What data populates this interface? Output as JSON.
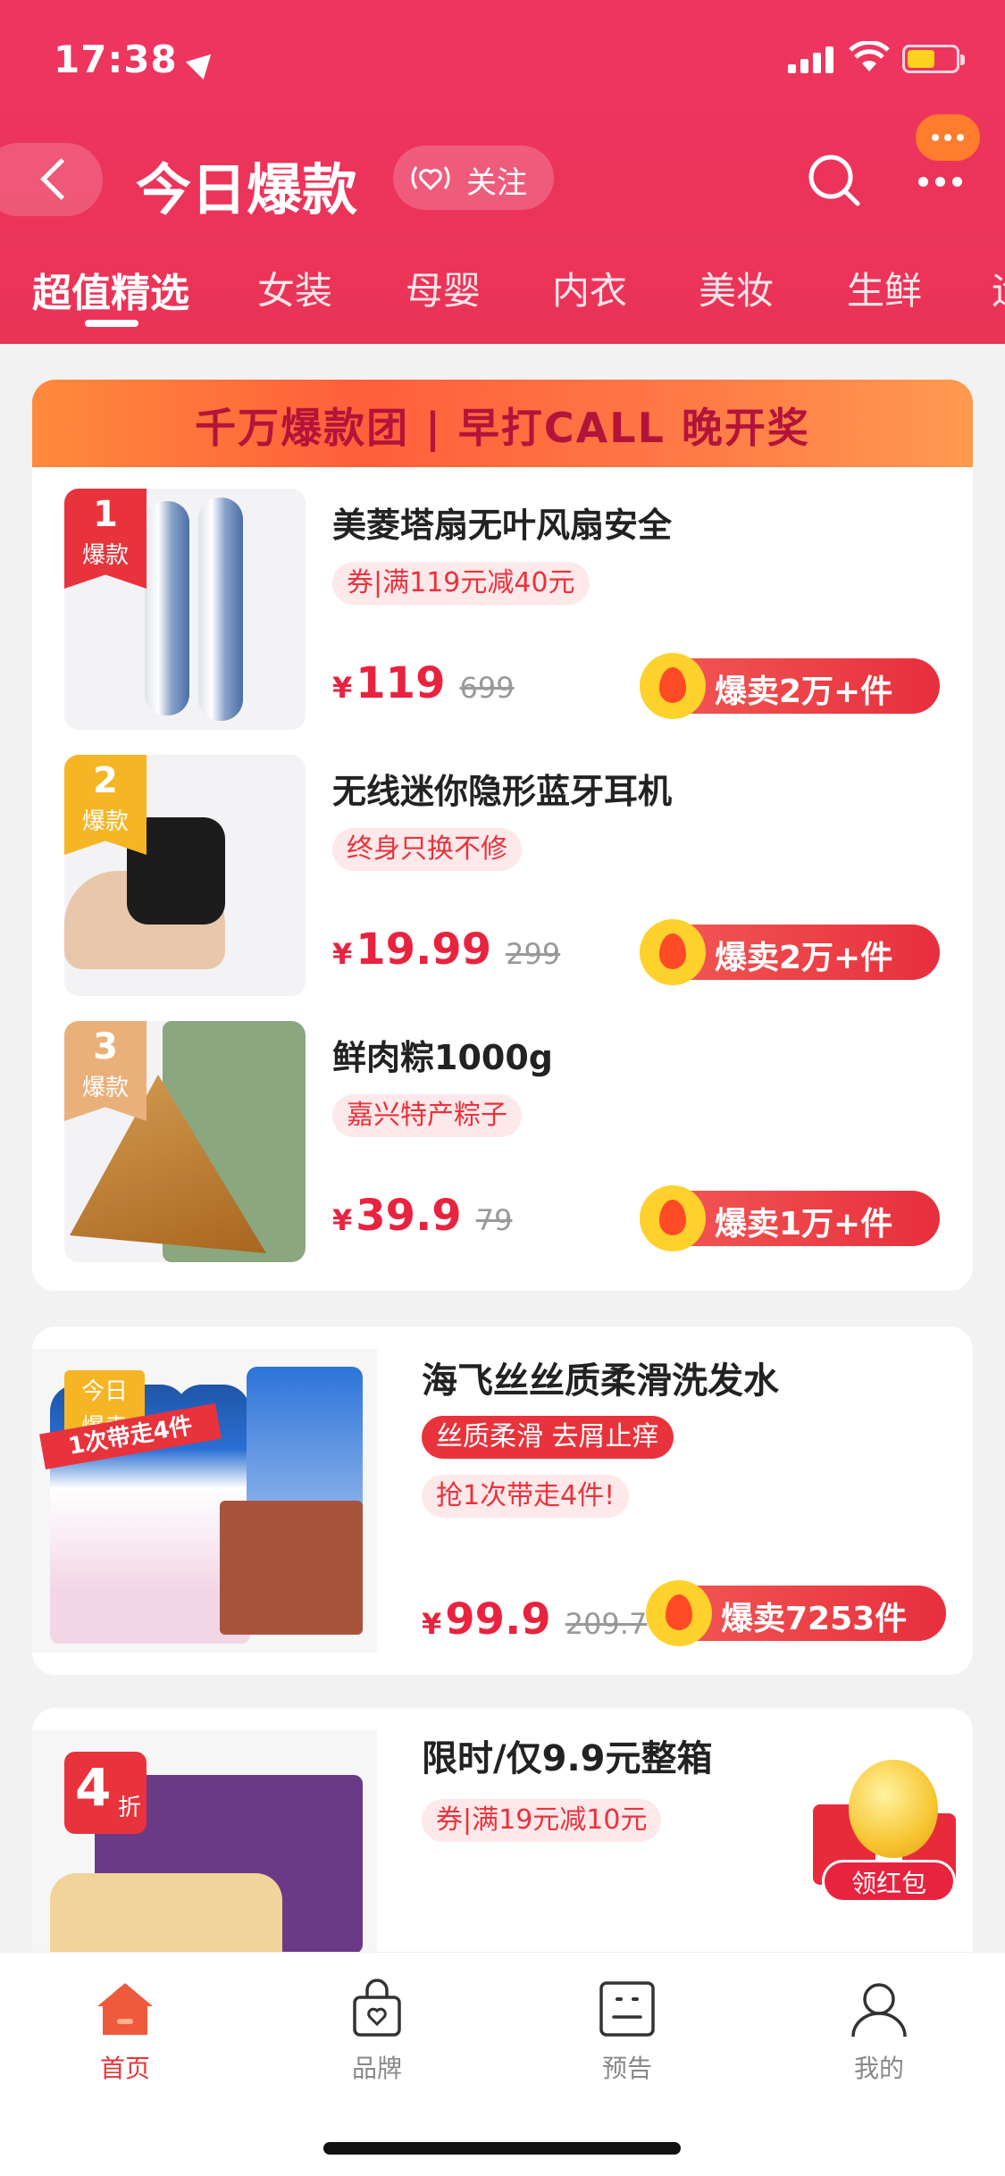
{
  "status_bar": {
    "time": "17:38"
  },
  "header": {
    "title": "今日爆款",
    "follow_label": "关注",
    "tabs": [
      "超值精选",
      "女装",
      "母婴",
      "内衣",
      "美妆",
      "生鲜",
      "运"
    ]
  },
  "ranking": {
    "banner": "千万爆款团 | 早打CALL 晚开奖",
    "items": [
      {
        "rank": "1",
        "rank_word": "爆款",
        "title": "美菱塔扇无叶风扇安全",
        "tag": "券|满119元减40元",
        "currency": "¥",
        "price": "119",
        "original_price": "699",
        "sales": "爆卖2万+件"
      },
      {
        "rank": "2",
        "rank_word": "爆款",
        "title": "无线迷你隐形蓝牙耳机",
        "tag": "终身只换不修",
        "currency": "¥",
        "price": "19.99",
        "original_price": "299",
        "sales": "爆卖2万+件"
      },
      {
        "rank": "3",
        "rank_word": "爆款",
        "title": "鲜肉粽1000g",
        "tag": "嘉兴特产粽子",
        "currency": "¥",
        "price": "39.9",
        "original_price": "79",
        "sales": "爆卖1万+件"
      }
    ]
  },
  "product_shampoo": {
    "badge_line1": "今日",
    "badge_line2": "爆卖",
    "promo_strip": "1次带走4件",
    "title": "海飞丝丝质柔滑洗发水",
    "tag_primary": "丝质柔滑 去屑止痒",
    "tag_secondary": "抢1次带走4件!",
    "currency": "¥",
    "price": "99.9",
    "original_price": "209.7",
    "sales": "爆卖7253件"
  },
  "product_bread": {
    "discount_num": "4",
    "discount_unit": "折",
    "title": "限时/仅9.9元整箱",
    "tag": "券|满19元减10元"
  },
  "red_packet": {
    "label": "领红包"
  },
  "tabbar": {
    "items": [
      "首页",
      "品牌",
      "预告",
      "我的"
    ]
  },
  "colors": {
    "brand": "#ea3456",
    "accent": "#e8333c",
    "gold": "#f6b524"
  }
}
